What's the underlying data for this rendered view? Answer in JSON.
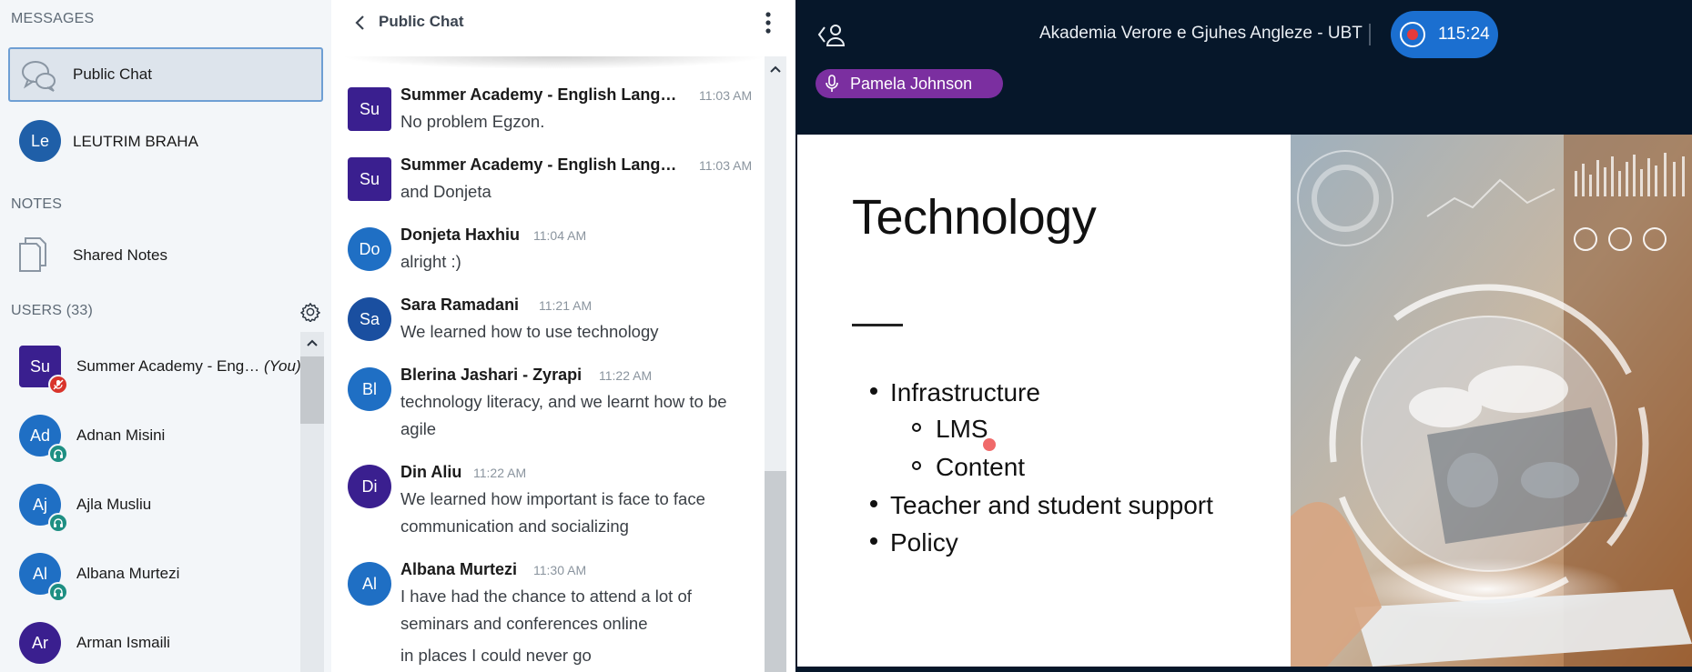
{
  "sidebar": {
    "messages_title": "MESSAGES",
    "public_chat_label": "Public Chat",
    "private_chats": [
      {
        "initials": "Le",
        "name": "LEUTRIM BRAHA",
        "color": "#1f5fa8"
      }
    ],
    "notes_title": "NOTES",
    "shared_notes_label": "Shared Notes",
    "users_title": "USERS (33)",
    "users": [
      {
        "initials": "Su",
        "name": "Summer Academy - Eng…",
        "you_label": "(You)",
        "color": "#3a1f8f",
        "status": "muted"
      },
      {
        "initials": "Ad",
        "name": "Adnan Misini",
        "color": "#1f6fc4",
        "status": "listen"
      },
      {
        "initials": "Aj",
        "name": "Ajla Musliu",
        "color": "#1f6fc4",
        "status": "listen"
      },
      {
        "initials": "Al",
        "name": "Albana Murtezi",
        "color": "#1f6fc4",
        "status": "listen"
      },
      {
        "initials": "Ar",
        "name": "Arman Ismaili",
        "color": "#3a1f8f",
        "status": "none"
      }
    ]
  },
  "chat": {
    "title": "Public Chat",
    "messages": [
      {
        "initials": "Su",
        "color": "#3a1f8f",
        "name": "Summer Academy - English Lang…",
        "time": "11:03 AM",
        "lines": [
          "No problem Egzon."
        ]
      },
      {
        "initials": "Su",
        "color": "#3a1f8f",
        "name": "Summer Academy - English Lang…",
        "time": "11:03 AM",
        "lines": [
          "and Donjeta"
        ]
      },
      {
        "initials": "Do",
        "color": "#1f6fc4",
        "name": "Donjeta Haxhiu",
        "time": "11:04 AM",
        "lines": [
          "alright :)"
        ]
      },
      {
        "initials": "Sa",
        "color": "#1a4fa0",
        "name": "Sara Ramadani",
        "time": "11:21 AM",
        "lines": [
          "We learned how to use technology"
        ]
      },
      {
        "initials": "Bl",
        "color": "#1f6fc4",
        "name": "Blerina Jashari - Zyrapi",
        "time": "11:22 AM",
        "lines": [
          "technology literacy, and we learnt how to be",
          "agile"
        ]
      },
      {
        "initials": "Di",
        "color": "#3a1f8f",
        "name": "Din Aliu",
        "time": "11:22 AM",
        "lines": [
          "We learned how important is face to face",
          "communication and socializing"
        ]
      },
      {
        "initials": "Al",
        "color": "#1f6fc4",
        "name": "Albana Murtezi",
        "time": "11:30 AM",
        "lines": [
          "I have had the chance to attend a lot of",
          "seminars and conferences online",
          "in places I could never go"
        ]
      }
    ]
  },
  "presentation": {
    "meeting_title": "Akademia Verore e Gjuhes Angleze - UBT",
    "recording_time": "115:24",
    "talker_name": "Pamela Johnson",
    "slide": {
      "title": "Technology",
      "bullets": [
        {
          "text": "Infrastructure",
          "level": 1
        },
        {
          "text": "LMS",
          "level": 2
        },
        {
          "text": "Content",
          "level": 2
        },
        {
          "text": "Teacher and student support",
          "level": 1
        },
        {
          "text": "Policy",
          "level": 1
        }
      ]
    }
  },
  "colors": {
    "accent_blue": "#1b6fd0",
    "talker_purple": "#7b2fa0",
    "listen_green": "#1e8f83",
    "muted_red": "#d9342b",
    "presentation_bg": "#06172a"
  },
  "icons": {
    "public_chat": "chat-bubbles-icon",
    "shared_notes": "notes-icon",
    "settings": "gear-icon",
    "back": "chevron-left-icon",
    "options": "kebab-menu-icon",
    "user_list_toggle": "user-list-toggle-icon",
    "record": "record-icon",
    "talker": "microphone-icon"
  }
}
